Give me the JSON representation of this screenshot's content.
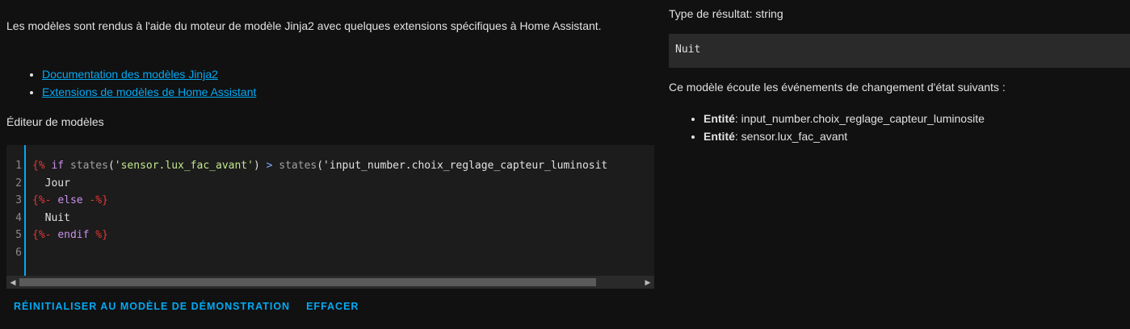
{
  "left": {
    "intro": "Les modèles sont rendus à l'aide du moteur de modèle Jinja2 avec quelques extensions spécifiques à Home Assistant.",
    "links": [
      {
        "label": "Documentation des modèles Jinja2"
      },
      {
        "label": "Extensions de modèles de Home Assistant"
      }
    ],
    "editor_title": "Éditeur de modèles",
    "editor": {
      "line_numbers": [
        "1",
        "2",
        "3",
        "4",
        "5",
        "6"
      ],
      "lines": [
        "{% if states('sensor.lux_fac_avant') > states('input_number.choix_reglage_capteur_luminosit",
        "  Jour",
        "{%- else -%}",
        "  Nuit",
        "{%- endif %}",
        ""
      ]
    },
    "buttons": {
      "reset": "Réinitialiser au modèle de démonstration",
      "clear": "Effacer"
    }
  },
  "right": {
    "result_type": "Type de résultat: string",
    "result_value": "Nuit",
    "listens_text": "Ce modèle écoute les événements de changement d'état suivants :",
    "entities": [
      {
        "label": "Entité",
        "value": ": input_number.choix_reglage_capteur_luminosite"
      },
      {
        "label": "Entité",
        "value": ": sensor.lux_fac_avant"
      }
    ]
  },
  "colors": {
    "accent": "#03a9f4",
    "background": "#111111",
    "code_background": "#1c1c1c",
    "result_background": "#2a2a2a"
  },
  "icons": {
    "scroll_left": "triangle-left-icon",
    "scroll_right": "triangle-right-icon"
  }
}
